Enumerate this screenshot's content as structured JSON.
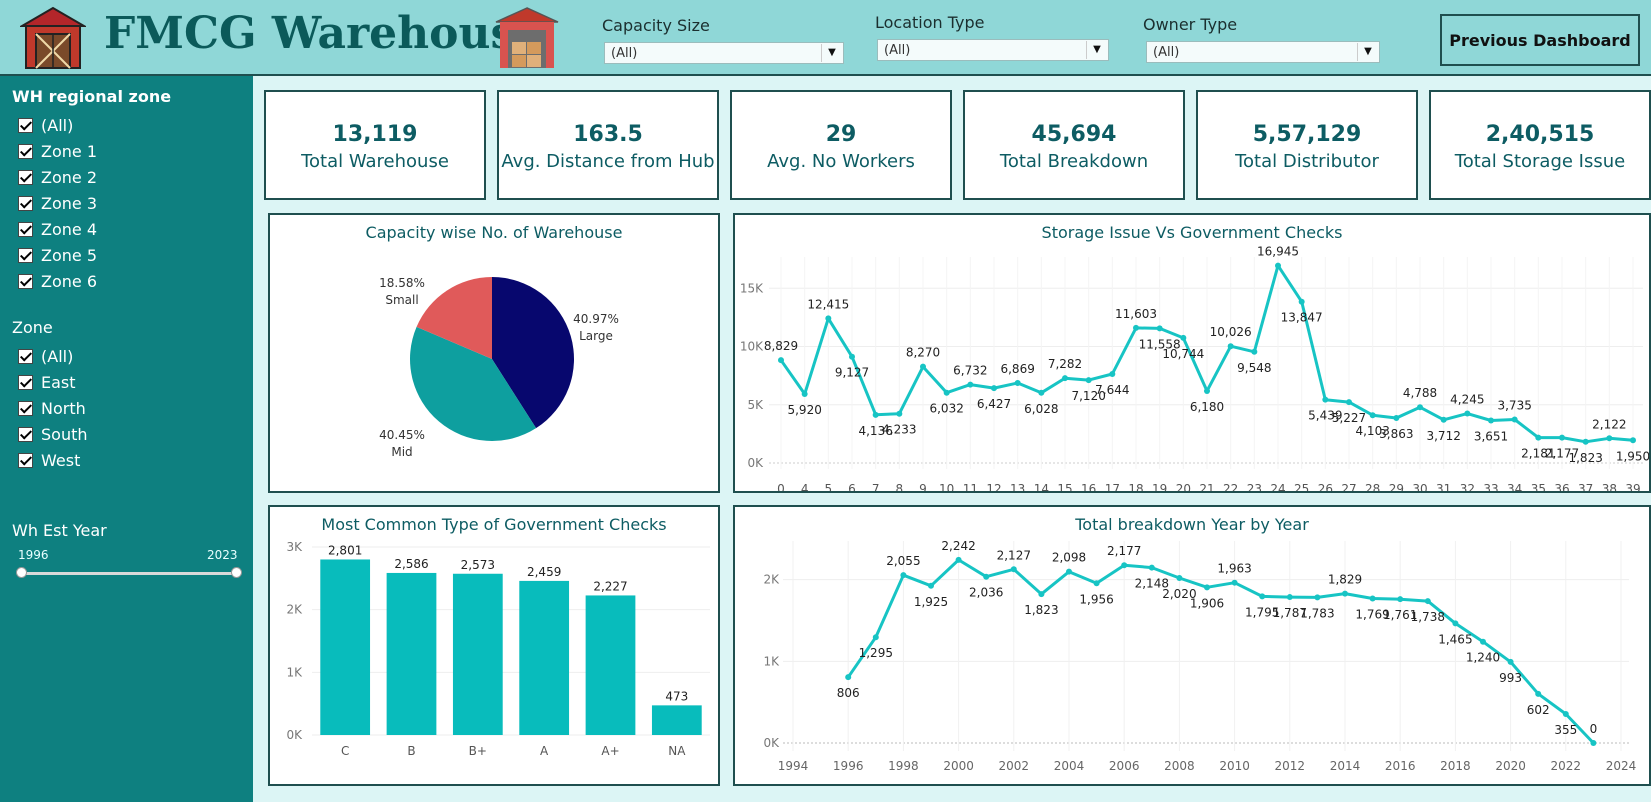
{
  "header": {
    "title": "FMCG Warehouse",
    "filters": [
      {
        "label": "Capacity Size",
        "value": "(All)"
      },
      {
        "label": "Location Type",
        "value": "(All)"
      },
      {
        "label": "Owner Type",
        "value": "(All)"
      }
    ],
    "prev_button": "Previous Dashboard"
  },
  "sidebar": {
    "regional": {
      "title": "WH regional zone",
      "items": [
        "(All)",
        "Zone 1",
        "Zone 2",
        "Zone 3",
        "Zone 4",
        "Zone 5",
        "Zone 6"
      ]
    },
    "zone": {
      "title": "Zone",
      "items": [
        "(All)",
        "East",
        "North",
        "South",
        "West"
      ]
    },
    "year": {
      "title": "Wh Est Year",
      "min": "1996",
      "max": "2023"
    }
  },
  "kpis": [
    {
      "value": "13,119",
      "label": "Total Warehouse"
    },
    {
      "value": "163.5",
      "label": "Avg. Distance from Hub"
    },
    {
      "value": "29",
      "label": "Avg. No  Workers"
    },
    {
      "value": "45,694",
      "label": "Total Breakdown"
    },
    {
      "value": "5,57,129",
      "label": "Total Distributor"
    },
    {
      "value": "2,40,515",
      "label": "Total Storage Issue"
    }
  ],
  "colors": {
    "accent": "#17c4c4",
    "bar": "#08bcbc",
    "navy": "#07076e",
    "teal": "#0e9f9f",
    "red": "#e05a5a"
  },
  "chart_data": [
    {
      "type": "pie",
      "title": "Capacity wise No. of Warehouse",
      "slices": [
        {
          "label": "Large",
          "pct": "40.97%",
          "value": 40.97,
          "color": "#07076e"
        },
        {
          "label": "Mid",
          "pct": "40.45%",
          "value": 40.45,
          "color": "#0e9f9f"
        },
        {
          "label": "Small",
          "pct": "18.58%",
          "value": 18.58,
          "color": "#e05a5a"
        }
      ]
    },
    {
      "type": "line",
      "title": "Storage Issue Vs Government Checks",
      "x": [
        0,
        4,
        5,
        6,
        7,
        8,
        9,
        10,
        11,
        12,
        13,
        14,
        15,
        16,
        17,
        18,
        19,
        20,
        21,
        22,
        23,
        24,
        25,
        26,
        27,
        28,
        29,
        30,
        31,
        32,
        33,
        34,
        35,
        36,
        37,
        38,
        39
      ],
      "values": [
        8829,
        5920,
        12415,
        9127,
        4136,
        4233,
        8270,
        6032,
        6732,
        6427,
        6869,
        6028,
        7282,
        7120,
        7644,
        11603,
        11558,
        10744,
        6180,
        10026,
        9548,
        16945,
        13847,
        5439,
        5227,
        4103,
        3863,
        4788,
        3712,
        4245,
        3651,
        3735,
        2181,
        2177,
        1823,
        2122,
        1950
      ],
      "labels": [
        "8,829",
        "5,920",
        "12,415",
        "9,127",
        "4,136",
        "4,233",
        "8,270",
        "6,032",
        "6,732",
        "6,427",
        "6,869",
        "6,028",
        "7,282",
        "7,120",
        "7,644",
        "11,603",
        "11,558",
        "10,744",
        "6,180",
        "10,026",
        "9,548",
        "16,945",
        "13,847",
        "5,439",
        "5,227",
        "4,103",
        "3,863",
        "4,788",
        "3,712",
        "4,245",
        "3,651",
        "3,735",
        "2,181",
        "2,177",
        "1,823",
        "2,122",
        "1,950"
      ],
      "yticks": [
        "0K",
        "5K",
        "10K",
        "15K"
      ],
      "ylim": [
        0,
        17000
      ]
    },
    {
      "type": "bar",
      "title": "Most Common Type of Government Checks",
      "categories": [
        "C",
        "B",
        "B+",
        "A",
        "A+",
        "NA"
      ],
      "values": [
        2801,
        2586,
        2573,
        2459,
        2227,
        473
      ],
      "labels": [
        "2,801",
        "2,586",
        "2,573",
        "2,459",
        "2,227",
        "473"
      ],
      "yticks": [
        "0K",
        "1K",
        "2K",
        "3K"
      ],
      "ylim": [
        0,
        3000
      ]
    },
    {
      "type": "line",
      "title": "Total breakdown Year by Year",
      "x": [
        1996,
        1997,
        1998,
        1999,
        2000,
        2001,
        2002,
        2003,
        2004,
        2005,
        2006,
        2007,
        2008,
        2009,
        2010,
        2011,
        2012,
        2013,
        2014,
        2015,
        2016,
        2017,
        2018,
        2019,
        2020,
        2021,
        2022,
        2023
      ],
      "values": [
        806,
        1295,
        2055,
        1925,
        2242,
        2036,
        2127,
        1823,
        2098,
        1956,
        2177,
        2148,
        2020,
        1906,
        1963,
        1795,
        1787,
        1783,
        1829,
        1769,
        1761,
        1738,
        1465,
        1240,
        993,
        602,
        355,
        0
      ],
      "labels": [
        "806",
        "1,295",
        "2,055",
        "1,925",
        "2,242",
        "2,036",
        "2,127",
        "1,823",
        "2,098",
        "1,956",
        "2,177",
        "2,148",
        "2,020",
        "1,906",
        "1,963",
        "1,795",
        "1,787",
        "1,783",
        "1,829",
        "1,769",
        "1,761",
        "1,738",
        "1,465",
        "1,240",
        "993",
        "602",
        "355",
        "0"
      ],
      "xticks": [
        "1994",
        "1996",
        "1998",
        "2000",
        "2002",
        "2004",
        "2006",
        "2008",
        "2010",
        "2012",
        "2014",
        "2016",
        "2018",
        "2020",
        "2022",
        "2024"
      ],
      "yticks": [
        "0K",
        "1K",
        "2K"
      ],
      "ylim": [
        0,
        2400
      ]
    }
  ]
}
